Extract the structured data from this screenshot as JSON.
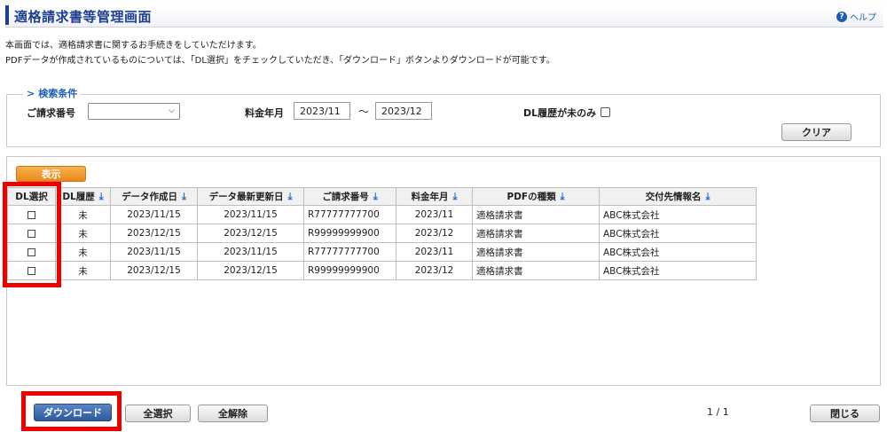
{
  "header": {
    "title": "適格請求書等管理画面",
    "help_label": "ヘルプ"
  },
  "description": [
    "本画面では、適格請求書に関するお手続きをしていただけます。",
    "PDFデータが作成されているものについては、「DL選択」をチェックしていただき、「ダウンロード」ボタンよりダウンロードが可能です。"
  ],
  "search": {
    "legend": "検索条件",
    "invoice_number_label": "ご請求番号",
    "invoice_number_value": "",
    "billing_month_label": "料金年月",
    "billing_month_from": "2023/11",
    "billing_month_to": "2023/12",
    "range_separator": "〜",
    "dl_unhistory_label": "DL履歴が未のみ",
    "clear_label": "クリア"
  },
  "results": {
    "show_label": "表示",
    "columns": [
      "DL選択",
      "DL履歴",
      "データ作成日",
      "データ最新更新日",
      "ご請求番号",
      "料金年月",
      "PDFの種類",
      "交付先情報名"
    ],
    "rows": [
      {
        "checked": false,
        "dl_history": "未",
        "created": "2023/11/15",
        "updated": "2023/11/15",
        "invoice_no": "R77777777700",
        "month": "2023/11",
        "pdf_type": "適格請求書",
        "recipient": "ABC株式会社"
      },
      {
        "checked": false,
        "dl_history": "未",
        "created": "2023/12/15",
        "updated": "2023/12/15",
        "invoice_no": "R99999999900",
        "month": "2023/12",
        "pdf_type": "適格請求書",
        "recipient": "ABC株式会社"
      },
      {
        "checked": false,
        "dl_history": "未",
        "created": "2023/11/15",
        "updated": "2023/11/15",
        "invoice_no": "R77777777700",
        "month": "2023/11",
        "pdf_type": "適格請求書",
        "recipient": "ABC株式会社"
      },
      {
        "checked": false,
        "dl_history": "未",
        "created": "2023/12/15",
        "updated": "2023/12/15",
        "invoice_no": "R99999999900",
        "month": "2023/12",
        "pdf_type": "適格請求書",
        "recipient": "ABC株式会社"
      }
    ]
  },
  "footer": {
    "download_label": "ダウンロード",
    "select_all_label": "全選択",
    "deselect_all_label": "全解除",
    "page_indicator": "1 / 1",
    "close_label": "閉じる"
  },
  "colors": {
    "title": "#1c3f8f",
    "accent_orange": "#e8871c",
    "download_blue": "#2d5a9d",
    "highlight_red": "#ee0000"
  }
}
